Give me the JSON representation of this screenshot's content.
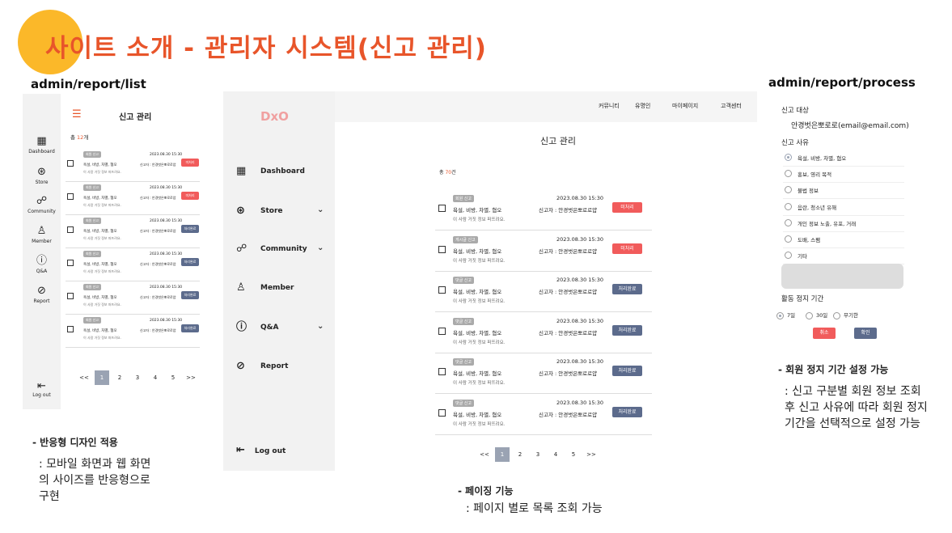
{
  "slide": {
    "title": "사이트 소개 - 관리자 시스템(신고 관리)",
    "routes": [
      "admin/report/list",
      "admin/report/process"
    ],
    "notes": [
      {
        "heading": "- 반응형 디자인 적용",
        "body": ": 모바일 화면과 웹 화면의 사이즈를 반응형으로 구현"
      },
      {
        "heading": "- 페이징 기능",
        "body": ": 페이지 별로 목록 조회 가능"
      },
      {
        "heading": "- 회원 정지 기간 설정 가능",
        "body": ": 신고 구분별 회원 정보 조회 후 신고 사유에 따라 회원 정지 기간을 선택적으로 설정 가능"
      }
    ],
    "colors": {
      "accent": "#E8552A",
      "circle": "#FBB829",
      "pending": "#F15B5B",
      "done": "#5C6B8C"
    }
  },
  "mobile": {
    "title": "신고 관리",
    "total_prefix": "총 ",
    "total_count": "12",
    "total_suffix": "개",
    "nav": [
      "Dashboard",
      "Store",
      "Community",
      "Member",
      "Q&A",
      "Report"
    ],
    "nav_icons": [
      "grid-icon",
      "store-icon",
      "community-icon",
      "member-icon",
      "question-icon",
      "report-icon"
    ],
    "logout": "Log out",
    "rows": [
      {
        "tag": "회원 신고",
        "reason": "욕설, 비방, 차별, 혐오",
        "desc": "이 사람 거짓 정보 퍼뜨려요.",
        "date": "2023.08.30 15:30",
        "reporter": "신고자 : 안경벗은뽀로로얍",
        "status": "미처리"
      },
      {
        "tag": "회원 신고",
        "reason": "욕설, 비방, 차별, 혐오",
        "desc": "이 사람 거짓 정보 퍼뜨려요.",
        "date": "2023.08.30 15:30",
        "reporter": "신고자 : 안경벗은뽀로로얍",
        "status": "미처리"
      },
      {
        "tag": "회원 신고",
        "reason": "욕설, 비방, 차별, 혐오",
        "desc": "이 사람 거짓 정보 퍼뜨려요.",
        "date": "2023.08.30 15:30",
        "reporter": "신고자 : 안경벗은뽀로로얍",
        "status": "처리완료"
      },
      {
        "tag": "회원 신고",
        "reason": "욕설, 비방, 차별, 혐오",
        "desc": "이 사람 거짓 정보 퍼뜨려요.",
        "date": "2023.08.30 15:30",
        "reporter": "신고자 : 안경벗은뽀로로얍",
        "status": "처리완료"
      },
      {
        "tag": "회원 신고",
        "reason": "욕설, 비방, 차별, 혐오",
        "desc": "이 사람 거짓 정보 퍼뜨려요.",
        "date": "2023.08.30 15:30",
        "reporter": "신고자 : 안경벗은뽀로로얍",
        "status": "처리완료"
      },
      {
        "tag": "회원 신고",
        "reason": "욕설, 비방, 차별, 혐오",
        "desc": "이 사람 거짓 정보 퍼뜨려요.",
        "date": "2023.08.30 15:30",
        "reporter": "신고자 : 안경벗은뽀로로얍",
        "status": "처리완료"
      }
    ],
    "pagination": [
      "<<",
      "1",
      "2",
      "3",
      "4",
      "5",
      ">>"
    ]
  },
  "desktop": {
    "logo": "DxO",
    "header_menu": [
      "커뮤니티",
      "유명인",
      "마이페이지",
      "고객센터"
    ],
    "nav": [
      "Dashboard",
      "Store",
      "Community",
      "Member",
      "Q&A",
      "Report"
    ],
    "nav_icons": [
      "grid-icon",
      "store-icon",
      "community-icon",
      "member-icon",
      "question-icon",
      "report-icon"
    ],
    "nav_has_chevron": [
      false,
      true,
      true,
      false,
      true,
      false
    ],
    "logout": "Log out",
    "title": "신고 관리",
    "total_prefix": "총 ",
    "total_count": "70",
    "total_suffix": "건",
    "rows": [
      {
        "tag": "회원 신고",
        "reason": "욕설, 비방, 차별, 혐오",
        "desc": "이 사람 거짓 정보 퍼뜨려요.",
        "date": "2023.08.30 15:30",
        "reporter": "신고자 : 안경벗은뽀로로얍",
        "status": "미처리"
      },
      {
        "tag": "게시글 신고",
        "reason": "욕설, 비방, 차별, 혐오",
        "desc": "이 사람 거짓 정보 퍼뜨려요.",
        "date": "2023.08.30 15:30",
        "reporter": "신고자 : 안경벗은뽀로로얍",
        "status": "미처리"
      },
      {
        "tag": "댓글 신고",
        "reason": "욕설, 비방, 차별, 혐오",
        "desc": "이 사람 거짓 정보 퍼뜨려요.",
        "date": "2023.08.30 15:30",
        "reporter": "신고자 : 안경벗은뽀로로얍",
        "status": "처리완료"
      },
      {
        "tag": "댓글 신고",
        "reason": "욕설, 비방, 차별, 혐오",
        "desc": "이 사람 거짓 정보 퍼뜨려요.",
        "date": "2023.08.30 15:30",
        "reporter": "신고자 : 안경벗은뽀로로얍",
        "status": "처리완료"
      },
      {
        "tag": "댓글 신고",
        "reason": "욕설, 비방, 차별, 혐오",
        "desc": "이 사람 거짓 정보 퍼뜨려요.",
        "date": "2023.08.30 15:30",
        "reporter": "신고자 : 안경벗은뽀로로얍",
        "status": "처리완료"
      },
      {
        "tag": "댓글 신고",
        "reason": "욕설, 비방, 차별, 혐오",
        "desc": "이 사람 거짓 정보 퍼뜨려요.",
        "date": "2023.08.30 15:30",
        "reporter": "신고자 : 안경벗은뽀로로얍",
        "status": "처리완료"
      }
    ],
    "pagination": [
      "<<",
      "1",
      "2",
      "3",
      "4",
      "5",
      ">>"
    ]
  },
  "process": {
    "target_label": "신고 대상",
    "target_value": "안경벗은뽀로로(email@email.com)",
    "reason_label": "신고 사유",
    "reasons": [
      "욕설, 비방, 차별, 혐오",
      "홍보, 영리 목적",
      "불법 정보",
      "음란, 청소년 유해",
      "개인 정보 노출, 유포, 거래",
      "도배, 스팸",
      "기타"
    ],
    "reason_selected": 0,
    "duration_label": "활동 정지 기간",
    "durations": [
      "7일",
      "30일",
      "무기한"
    ],
    "duration_selected": 0,
    "cancel": "취소",
    "confirm": "확인"
  }
}
